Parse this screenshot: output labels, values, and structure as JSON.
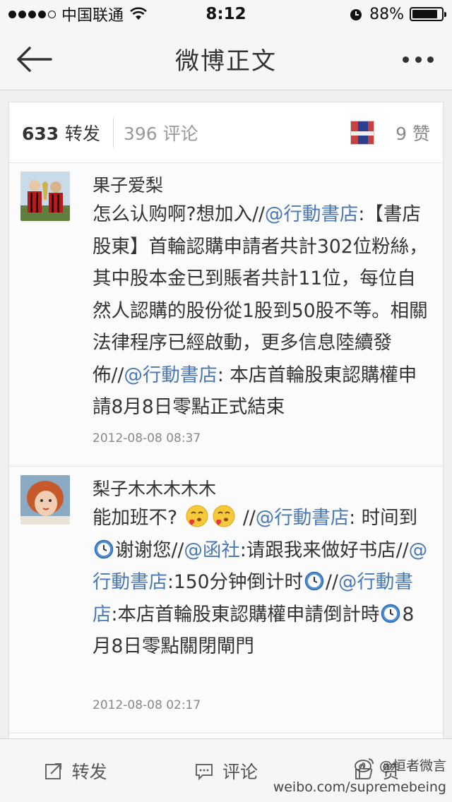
{
  "status_bar": {
    "carrier": "中国联通",
    "time": "8:12",
    "battery_text": "88%",
    "battery_level": 0.88
  },
  "nav": {
    "title": "微博正文"
  },
  "tabs": {
    "repost_count": "633",
    "repost_label": "转发",
    "comment_count": "396",
    "comment_label": "评论",
    "like_count": "9",
    "like_label": "赞"
  },
  "reposts": [
    {
      "username": "果子爱梨",
      "segments": [
        {
          "t": "怎么认购啊?想加入//"
        },
        {
          "t": "@行動書店",
          "m": true
        },
        {
          "t": ":【書店股東】首輪認購申請者共計302位粉絲，其中股本金已到賬者共計11位，每位自然人認購的股份從1股到50股不等。相關法律程序已經啟動，更多信息陸續發佈//"
        },
        {
          "t": "@行動書店",
          "m": true
        },
        {
          "t": ": 本店首輪股東認購權申請8月8日零點正式結束"
        }
      ],
      "time": "2012-08-08 08:37"
    },
    {
      "username": "梨子木木木木木",
      "segments": [
        {
          "t": "能加班不? "
        },
        {
          "emoji": "kiss-emoji"
        },
        {
          "emoji": "kiss-emoji"
        },
        {
          "t": " //"
        },
        {
          "t": "@行動書店",
          "m": true
        },
        {
          "t": ": 时间到"
        },
        {
          "emoji": "clock-icon"
        },
        {
          "t": "谢谢您//"
        },
        {
          "t": "@函社",
          "m": true
        },
        {
          "t": ":请跟我来做好书店//"
        },
        {
          "t": "@行動書店",
          "m": true
        },
        {
          "t": ":150分钟倒计时"
        },
        {
          "emoji": "clock-icon"
        },
        {
          "t": "//"
        },
        {
          "t": "@行動書店",
          "m": true
        },
        {
          "t": ":本店首輪股東認購權申請倒計時"
        },
        {
          "emoji": "clock-icon"
        },
        {
          "t": "8月8日零點關閉閘門"
        }
      ],
      "time": "2012-08-08 02:17"
    }
  ],
  "bottom_bar": {
    "repost": "转发",
    "comment": "评论",
    "like": "赞"
  },
  "watermark": {
    "line1": "@恒者微言",
    "line2": "weibo.com/supremebeing"
  }
}
